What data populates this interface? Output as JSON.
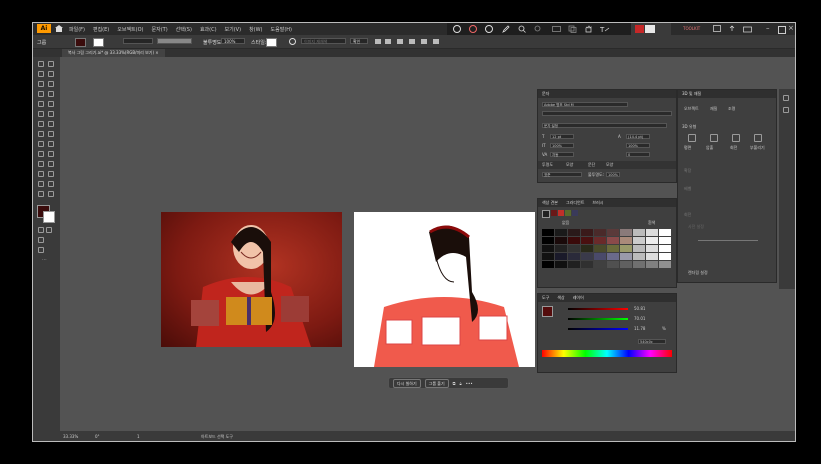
{
  "app": {
    "logo": "Ai",
    "file_tab": "복사 그림 그리기.ai* @ 33.33%(RGB/미리 보기)"
  },
  "menus": [
    "파일(F)",
    "편집(E)",
    "오브젝트(O)",
    "문자(T)",
    "선택(S)",
    "효과(C)",
    "보기(V)",
    "창(W)",
    "도움말(H)"
  ],
  "top_right": {
    "badge": "TOOLKIT"
  },
  "control_bar": {
    "object_label": "그룹",
    "opacity_label": "불투명도:",
    "opacity_value": "100%",
    "style_label": "스타일:",
    "recolor_label": "이미지 재채색",
    "transform_label": "확인"
  },
  "context_bar": {
    "regenerate": "다시 칠하기",
    "group_label": "그룹 풀기",
    "more": "•••"
  },
  "character_panel": {
    "title": "문자",
    "font": "Adobe 명조 Std M",
    "search_label": "문자 설정",
    "size": "12 pt",
    "leading": "(14.4 pt)",
    "hscale": "100%",
    "vscale": "100%",
    "auto_label": "자동",
    "tracking": "0",
    "kerning_pct": "0%",
    "tabs": [
      "투명도",
      "모양",
      "문단",
      "모양"
    ],
    "blend_mode": "표준",
    "opacity_label": "불투명도:",
    "opacity_value": "100%"
  },
  "swatches_panel": {
    "tabs": [
      "색상 견본",
      "그라디언트",
      "브러시"
    ],
    "col1": "없음",
    "col2": "흰색"
  },
  "color_panel": {
    "tabs": [
      "도구",
      "색상",
      "레이어"
    ],
    "r_value": "50.81",
    "g_value": "70.01",
    "b_value": "11.78",
    "hex": "540c0c",
    "pct": "%"
  },
  "props_panel": {
    "tabs": [
      "속성",
      "레이어",
      "라이브러리"
    ],
    "section": "3D 및 재질",
    "subtab1": "오브젝트",
    "subtab2": "재질",
    "subtab3": "조명",
    "type_label": "3D 유형",
    "types": [
      "평면",
      "압출",
      "회전",
      "부풀리기"
    ],
    "expand_label": "확장",
    "bevel_label": "베벨",
    "rotation_label": "회전",
    "preset_label": "사전 설정",
    "export_label": "렌더링 설정"
  },
  "statusbar": {
    "zoom": "33.33%",
    "angle": "0°",
    "page": "1",
    "tool": "아트보드 선택 도구"
  }
}
